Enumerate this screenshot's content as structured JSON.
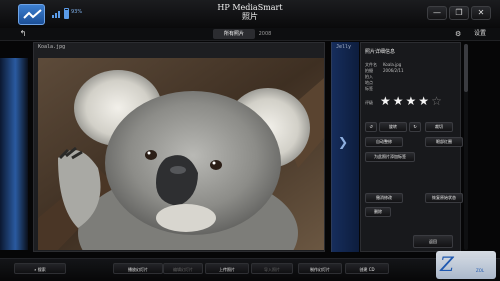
{
  "titlebar": {
    "app_name": "HP MediaSmart",
    "section": "照片",
    "battery_percent": "93%",
    "icons": [
      "hp-logo-icon",
      "signal-icon",
      "battery-icon",
      "minimize-icon",
      "restore-icon",
      "close-icon"
    ]
  },
  "nav": {
    "back_icon": "back-arrow-icon",
    "tabs": [
      {
        "label": "所有照片",
        "active": true
      },
      {
        "label": "2008",
        "active": false
      }
    ],
    "settings_label": "设置"
  },
  "viewer": {
    "current_file": "Koala.jpg",
    "next_file": "Jelly"
  },
  "details": {
    "title": "照片详细信息",
    "rows": [
      {
        "label": "文件名",
        "value": "Koala.jpg"
      },
      {
        "label": "拍摄",
        "value": "2006/2/11"
      },
      {
        "label": "拍入",
        "value": ""
      },
      {
        "label": "地点",
        "value": ""
      },
      {
        "label": "标签",
        "value": ""
      },
      {
        "label": "评级",
        "value": ""
      }
    ],
    "rating": 4,
    "rating_max": 5,
    "buttons": {
      "rotate_label": "旋转",
      "crop_label": "裁切",
      "auto_adjust": "自动整修",
      "red_eye": "眼部红圈",
      "add_tag": "为此照片添加标签",
      "undo": "撤消修改",
      "restore": "恢复原始状态",
      "delete": "删除",
      "back": "返回"
    }
  },
  "toolbar": {
    "search": "搜索",
    "slideshow": "播放幻灯片",
    "edit_slideshow": "编辑幻灯片",
    "upload": "上传照片",
    "import": "导入照片",
    "make_slideshow": "制作幻灯片",
    "create_cd": "创建 CD"
  },
  "colors": {
    "accent": "#3d7fd0",
    "background": "#060607",
    "panel": "#18191c"
  }
}
